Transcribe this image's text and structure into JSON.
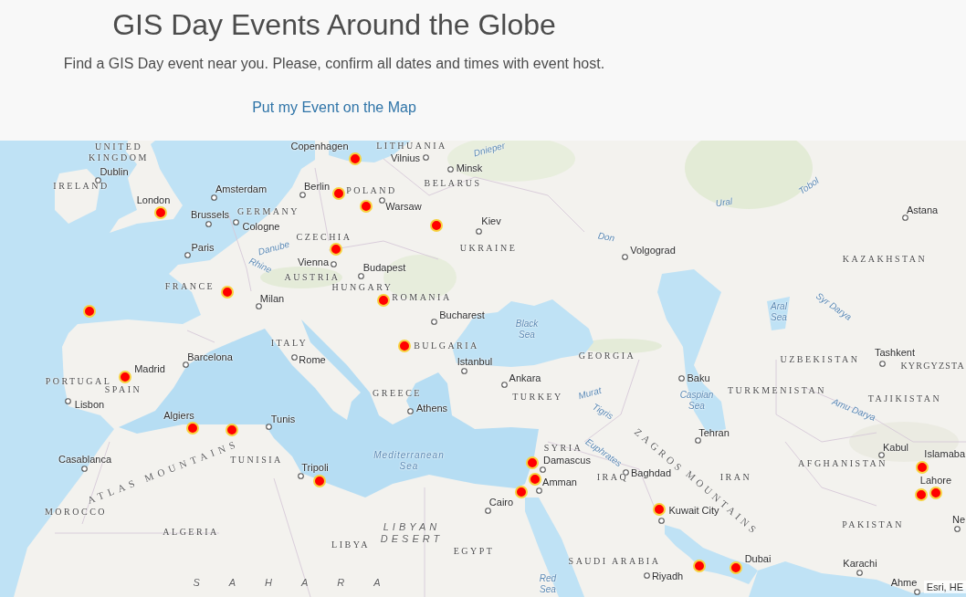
{
  "header": {
    "title": "GIS Day Events Around the Globe",
    "subtitle": "Find a GIS Day event near you. Please, confirm all dates and times with event host.",
    "link": "Put my Event on the Map"
  },
  "map": {
    "countries": [
      "UNITED KINGDOM",
      "LITHUANIA",
      "IRELAND",
      "POLAND",
      "BELARUS",
      "GERMANY",
      "CZECHIA",
      "UKRAINE",
      "KAZAKHSTAN",
      "AUSTRIA",
      "FRANCE",
      "HUNGARY",
      "ROMANIA",
      "ITALY",
      "BULGARIA",
      "GEORGIA",
      "UZBEKISTAN",
      "KYRGYZSTA",
      "PORTUGAL",
      "SPAIN",
      "GREECE",
      "TURKEY",
      "TURKMENISTAN",
      "TAJIKISTAN",
      "SYRIA",
      "TUNISIA",
      "AFGHANISTAN",
      "IRAQ",
      "IRAN",
      "MOROCCO",
      "ALGERIA",
      "PAKISTAN",
      "LIBYA",
      "EGYPT",
      "SAUDI ARABIA"
    ],
    "cities": [
      "Copenhagen",
      "Vilnius",
      "Dublin",
      "Minsk",
      "Amsterdam",
      "Berlin",
      "London",
      "Brussels",
      "Warsaw",
      "Astana",
      "Cologne",
      "Kiev",
      "Paris",
      "Volgograd",
      "Vienna",
      "Budapest",
      "Milan",
      "Bucharest",
      "Madrid",
      "Barcelona",
      "Rome",
      "Istanbul",
      "Tashkent",
      "Ankara",
      "Baku",
      "Lisbon",
      "Algiers",
      "Tunis",
      "Athens",
      "Tehran",
      "Casablanca",
      "Tripoli",
      "Damascus",
      "Baghdad",
      "Kabul",
      "Islamaba",
      "Amman",
      "Lahore",
      "Cairo",
      "Kuwait City",
      "Ne",
      "Dubai",
      "Karachi",
      "Riyadh",
      "Ahme"
    ],
    "water": [
      "Dnieper",
      "Tobol",
      "Ural",
      "Danube",
      "Don",
      "Rhine",
      "Black Sea",
      "Aral Sea",
      "Syr Darya",
      "Murat",
      "Tigris",
      "Caspian Sea",
      "Amu Darya",
      "Mediterranean Sea",
      "Euphrates",
      "Red Sea"
    ],
    "regions": [
      "ATLAS MOUNTAINS",
      "LIBYAN DESERT",
      "ZAGROS",
      "MOUNTAINS",
      "SAHARA"
    ],
    "attribution": "Esri, HE"
  }
}
